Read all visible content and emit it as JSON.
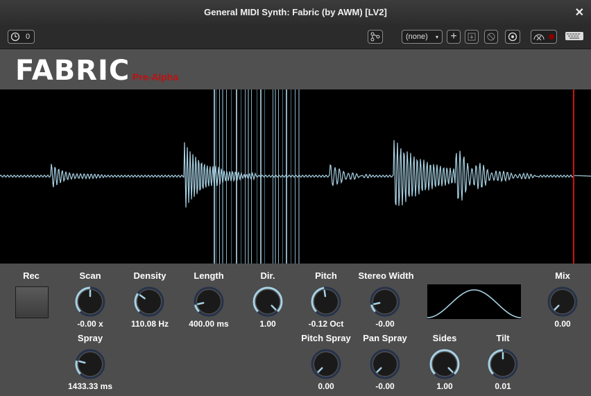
{
  "window": {
    "title": "General MIDI Synth: Fabric (by AWM) [LV2]",
    "close": "✕"
  },
  "toolbar": {
    "counter": "0",
    "preset": "(none)",
    "add": "+"
  },
  "header": {
    "logo": "FABRIC",
    "subtitle": "Pre-Alpha"
  },
  "controls": {
    "rec": {
      "label": "Rec"
    },
    "scan": {
      "label": "Scan",
      "value": "-0.00 x",
      "level": 0.5
    },
    "density": {
      "label": "Density",
      "value": "110.08 Hz",
      "level": 0.3
    },
    "length": {
      "label": "Length",
      "value": "400.00 ms",
      "level": 0.12
    },
    "dir": {
      "label": "Dir.",
      "value": "1.00",
      "level": 1.0
    },
    "pitch": {
      "label": "Pitch",
      "value": "-0.12 Oct",
      "level": 0.47
    },
    "stereo_width": {
      "label": "Stereo Width",
      "value": "-0.00",
      "level": 0.12
    },
    "mix": {
      "label": "Mix",
      "value": "0.00",
      "level": 0.0
    },
    "spray": {
      "label": "Spray",
      "value": "1433.33 ms",
      "level": 0.22
    },
    "pitch_spray": {
      "label": "Pitch Spray",
      "value": "0.00",
      "level": 0.0
    },
    "pan_spray": {
      "label": "Pan Spray",
      "value": "-0.00",
      "level": 0.0
    },
    "sides": {
      "label": "Sides",
      "value": "1.00",
      "level": 1.0
    },
    "tilt": {
      "label": "Tilt",
      "value": "0.01",
      "level": 0.5
    }
  },
  "colors": {
    "accent": "#a8d2e4",
    "marker": "#d01010",
    "knob": "#1a1a1a",
    "track": "#26324a"
  }
}
